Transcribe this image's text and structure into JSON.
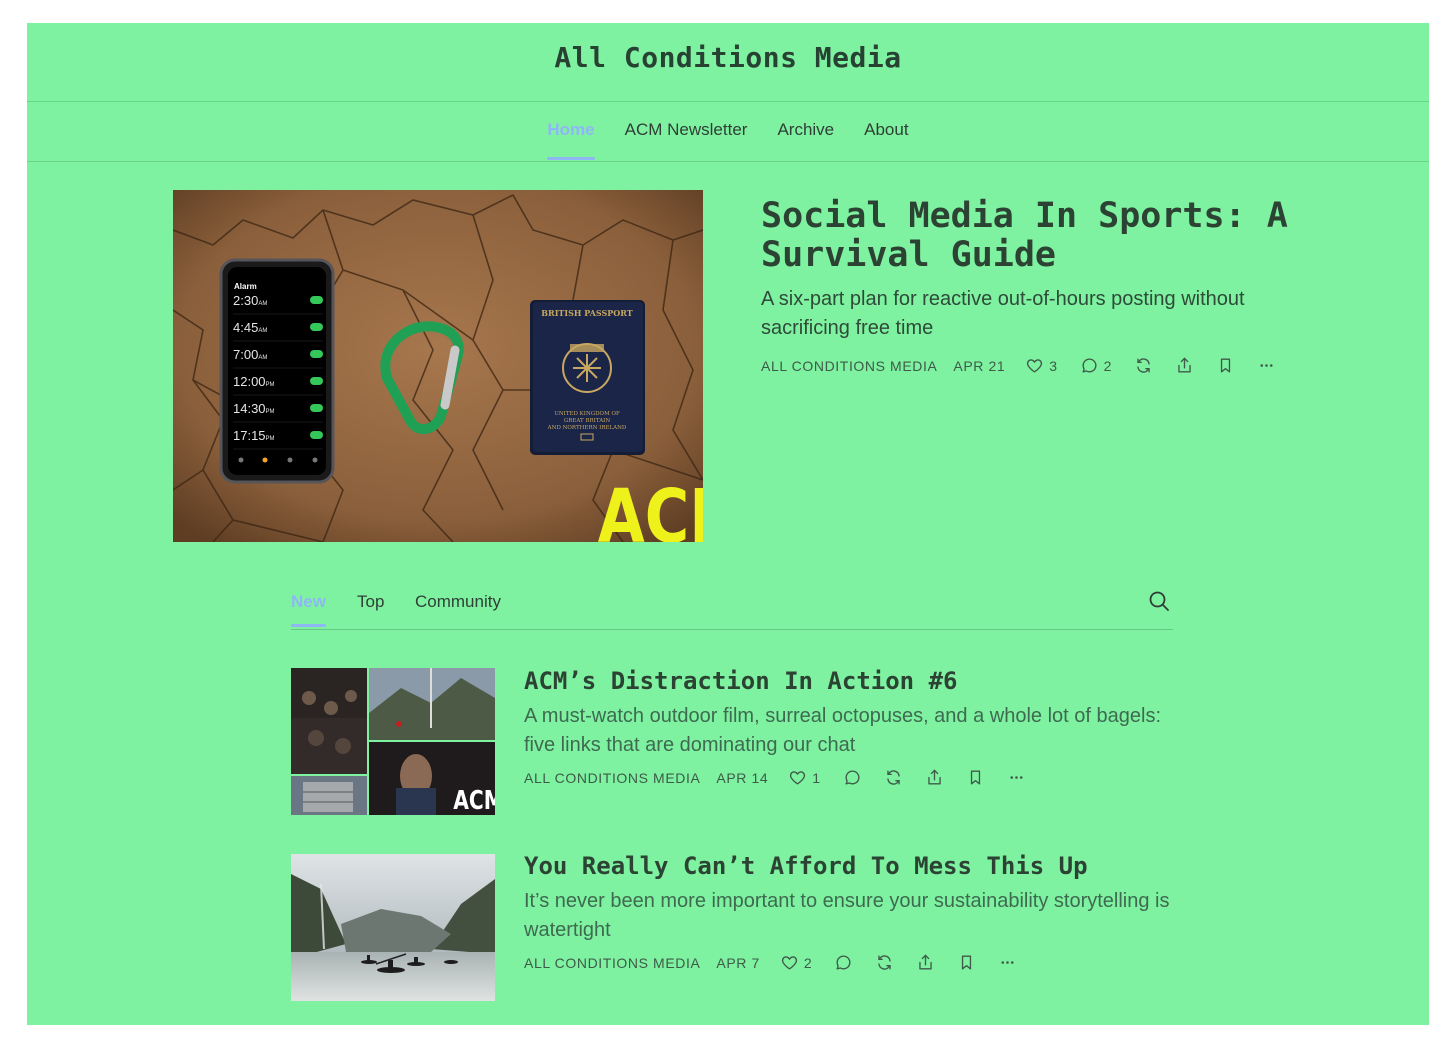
{
  "site": {
    "title": "All Conditions Media"
  },
  "nav": {
    "items": [
      "Home",
      "ACM Newsletter",
      "Archive",
      "About"
    ],
    "active": "Home"
  },
  "hero": {
    "title": "Social Media In Sports: A Survival Guide",
    "subtitle": "A six-part plan for reactive out-of-hours posting without sacrificing free time",
    "author": "ALL CONDITIONS MEDIA",
    "date": "APR 21",
    "likes": "3",
    "comments": "2",
    "image": {
      "phone_header": "Alarm",
      "alarms": [
        "2:30",
        "4:45",
        "7:00",
        "12:00",
        "14:30",
        "17:15"
      ],
      "alarm_suffix": [
        "AM",
        "AM",
        "AM",
        "PM",
        "PM",
        "PM"
      ],
      "passport_top": "BRITISH PASSPORT",
      "passport_bottom": "UNITED KINGDOM OF GREAT BRITAIN AND NORTHERN IRELAND",
      "logo": "ACM"
    }
  },
  "tabs": {
    "items": [
      "New",
      "Top",
      "Community"
    ],
    "active": "New"
  },
  "posts": [
    {
      "title": "ACM’s Distraction In Action #6",
      "subtitle": "A must-watch outdoor film, surreal octopuses, and a whole lot of bagels: five links that are dominating our chat",
      "author": "ALL CONDITIONS MEDIA",
      "date": "APR 14",
      "likes": "1",
      "comments": "",
      "image_logo": "ACM"
    },
    {
      "title": "You Really Can’t Afford To Mess This Up",
      "subtitle": "It’s never been more important to ensure your sustainability storytelling is watertight",
      "author": "ALL CONDITIONS MEDIA",
      "date": "APR 7",
      "likes": "2",
      "comments": ""
    }
  ],
  "icons": [
    "heart-icon",
    "comment-icon",
    "restack-icon",
    "share-icon",
    "bookmark-icon",
    "more-icon",
    "search-icon"
  ],
  "colors": {
    "background": "#7ef2a1",
    "accent": "#8fb6f5",
    "text": "#2c4233"
  }
}
